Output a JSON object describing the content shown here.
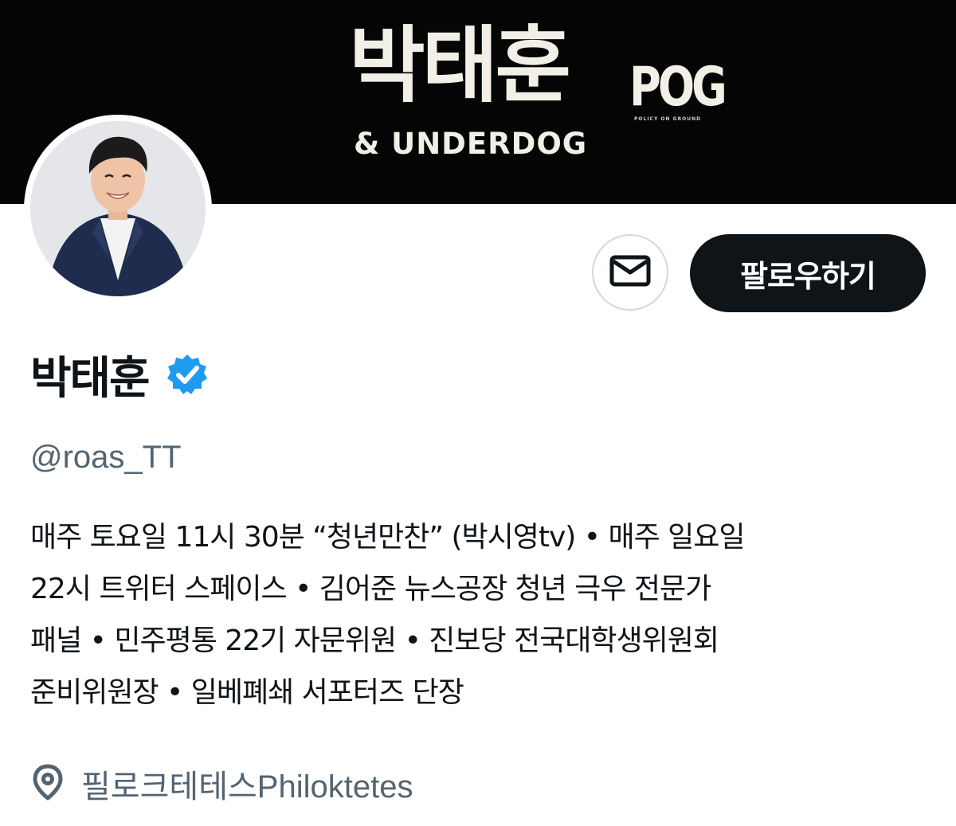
{
  "banner": {
    "name": "박태훈",
    "subtitle": "& UNDERDOG",
    "logo": "POG",
    "logo_tagline": "POLICY ON GROUND"
  },
  "profile": {
    "display_name": "박태훈",
    "verified": true,
    "handle": "@roas_TT",
    "bio_lines": [
      "매주 토요일 11시 30분 “청년만찬” (박시영tv) • 매주 일요일",
      "22시 트위터 스페이스 • 김어준 뉴스공장 청년 극우 전문가",
      "패널 • 민주평통 22기 자문위원 • 진보당 전국대학생위원회",
      "준비위원장 • 일베폐쇄 서포터즈 단장"
    ],
    "location": "필로크테테스Philoktetes"
  },
  "actions": {
    "follow_label": "팔로우하기",
    "message_icon": "mail-icon"
  },
  "icons": {
    "verified": "verified-badge-icon",
    "location": "location-pin-icon"
  },
  "colors": {
    "banner_bg": "#050505",
    "follow_bg": "#0f1419",
    "verified_blue": "#1d9bf0",
    "secondary_text": "#536471"
  }
}
